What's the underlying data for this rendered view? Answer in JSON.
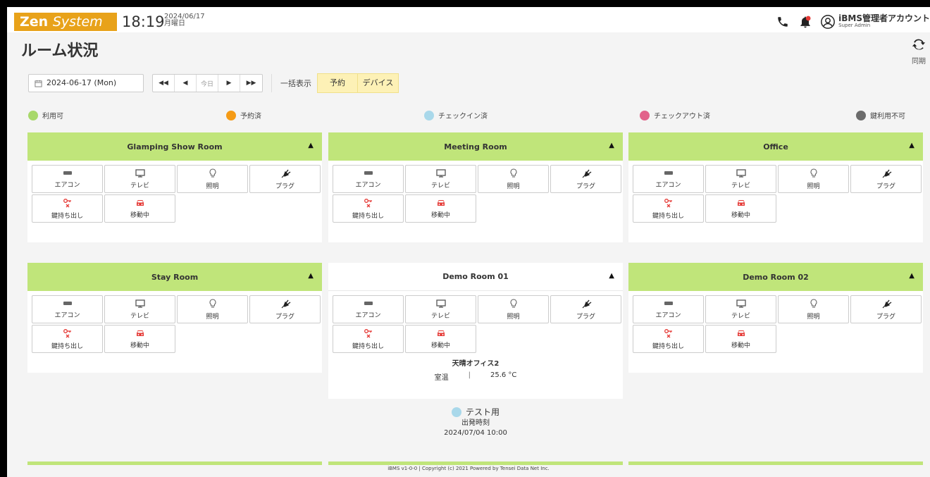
{
  "header": {
    "logo_zen": "Zen",
    "logo_system": "System",
    "time": "18:19",
    "date_line1": "2024/06/17",
    "date_line2": "月曜日",
    "user_name": "iBMS管理者アカウント",
    "user_role": "Super Admin",
    "icons": [
      "phone-icon",
      "bell-icon",
      "user-circle-icon"
    ]
  },
  "page": {
    "title": "ルーム状況",
    "sync_label": "同期"
  },
  "toolbar": {
    "date_value": "2024-06-17 (Mon)",
    "nav": [
      "◀◀",
      "◀",
      "今日",
      "▶",
      "▶▶"
    ],
    "bulk_label": "一括表示",
    "toggle_reservation": "予約",
    "toggle_device": "デバイス"
  },
  "legend": [
    {
      "label": "利用可",
      "color": "#a8d86a"
    },
    {
      "label": "予約済",
      "color": "#f59b16"
    },
    {
      "label": "チェックイン済",
      "color": "#a9d8ea"
    },
    {
      "label": "チェックアウト済",
      "color": "#e2628a"
    },
    {
      "label": "鍵利用不可",
      "color": "#6b6b6b"
    }
  ],
  "tile_labels": {
    "aircon": "エアコン",
    "tv": "テレビ",
    "light": "照明",
    "plug": "プラグ",
    "key_out": "鍵持ち出し",
    "moving": "移動中"
  },
  "rooms": [
    {
      "name": "Glamping Show Room"
    },
    {
      "name": "Meeting Room"
    },
    {
      "name": "Office"
    },
    {
      "name": "Stay Room"
    },
    {
      "name": "Demo Room 01",
      "sensor_name": "天晴オフィス2",
      "sensor_label": "室温",
      "sensor_sep": "|",
      "sensor_value": "25.6 °C"
    },
    {
      "name": "Demo Room 02"
    }
  ],
  "reservation": {
    "title": "テスト用",
    "label": "出発時刻",
    "datetime": "2024/07/04 10:00"
  },
  "footer": "iBMS v1-0-0 | Copyright (c) 2021 Powered by Tensei Data Net Inc.",
  "colors": {
    "accent_green": "#c0e57a",
    "logo_orange": "#e8a21a",
    "toggle_yellow": "#fdf1b6",
    "alert_red": "#e53935"
  }
}
